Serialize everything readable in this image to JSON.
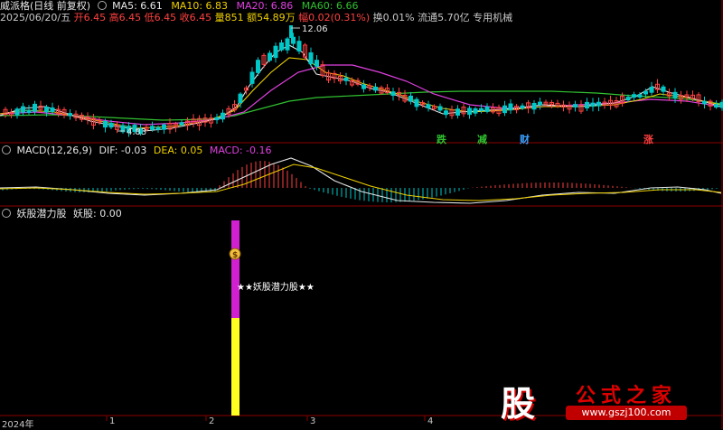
{
  "stock": {
    "name": "威派格(日线 前复权)"
  },
  "ma_labels": {
    "ma5": "MA5: 6.61",
    "ma10": "MA10: 6.83",
    "ma20": "MA20: 6.86",
    "ma60": "MA60: 6.66"
  },
  "quote": {
    "date": "2025/06/20/五",
    "open": "开6.45",
    "high": "高6.45",
    "low": "低6.45",
    "close": "收6.45",
    "volume": "量851",
    "amount": "额54.89万",
    "change": "幅0.02(0.31%)",
    "turnover": "换0.01%",
    "float": "流通5.70亿",
    "sector": "专用机械"
  },
  "price_marks": {
    "high_label": "12.06",
    "low_label": "4.83"
  },
  "signal_tags": [
    {
      "label": "跌",
      "color": "#30c030"
    },
    {
      "label": "减",
      "color": "#30c030"
    },
    {
      "label": "财",
      "color": "#3aa0ff"
    },
    {
      "label": "涨",
      "color": "#ff4040"
    }
  ],
  "macd": {
    "title": "MACD(12,26,9)",
    "dif": "DIF: -0.03",
    "dea": "DEA: 0.05",
    "macd": "MACD: -0.16"
  },
  "indicator": {
    "title": "妖股潜力股",
    "value": "妖股: 0.00",
    "annotation": "★★妖股潜力股★★",
    "coin": "$"
  },
  "x_axis": {
    "ticks": [
      "2024年",
      "1",
      "2",
      "3",
      "4"
    ]
  },
  "watermark": {
    "gu": "股",
    "title": "公式之家",
    "url": "www.gszj100.com"
  },
  "colors": {
    "up": "#ff4040",
    "down": "#00c8c8",
    "ma5": "#e6e6e6",
    "ma10": "#f0d000",
    "ma20": "#e040e0",
    "ma60": "#30c030",
    "bar_top": "#d020d0",
    "bar_bottom": "#ffff20"
  }
}
